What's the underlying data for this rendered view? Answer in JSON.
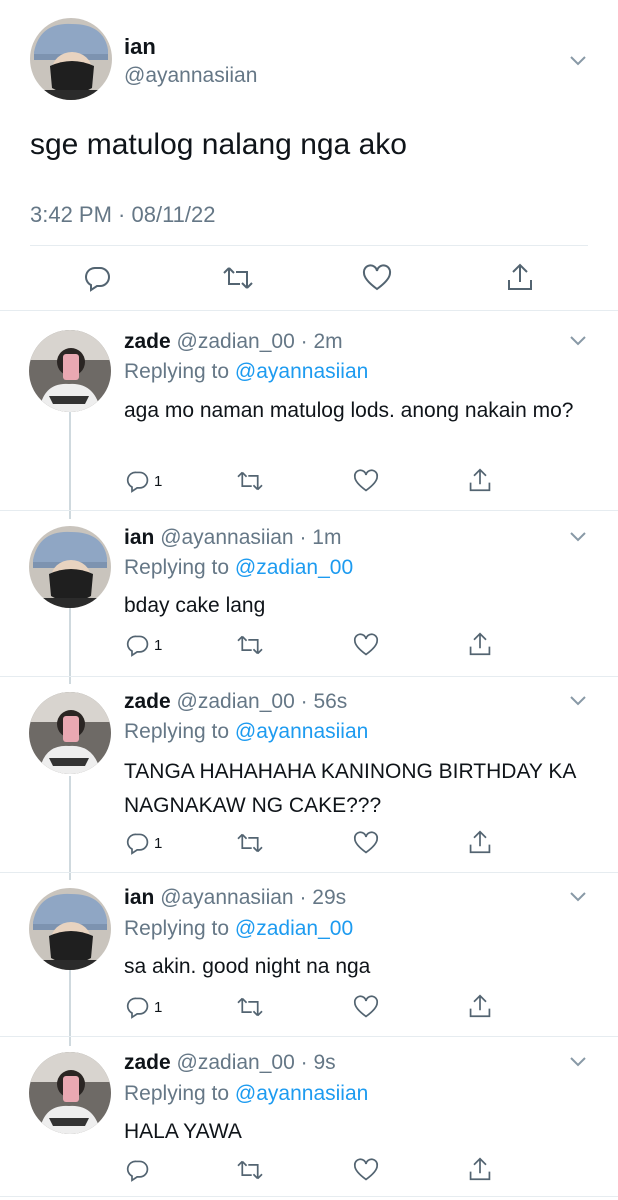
{
  "main_tweet": {
    "author_name": "ian",
    "author_handle": "@ayannasiian",
    "text": "sge matulog nalang nga ako",
    "timestamp": "3:42 PM · 08/11/22"
  },
  "replies": [
    {
      "name": "zade",
      "handle": "@zadian_00",
      "time": "· 2m",
      "replying_prefix": "Replying to",
      "replying_to": "@ayannasiian",
      "text": "aga mo naman matulog lods. anong nakain mo?",
      "reply_count": "1"
    },
    {
      "name": "ian",
      "handle": "@ayannasiian",
      "time": "· 1m",
      "replying_prefix": "Replying to",
      "replying_to": "@zadian_00",
      "text": "bday cake lang",
      "reply_count": "1"
    },
    {
      "name": "zade",
      "handle": "@zadian_00",
      "time": "· 56s",
      "replying_prefix": "Replying to",
      "replying_to": "@ayannasiian",
      "text": "TANGA HAHAHAHA KANINONG BIRTHDAY KA NAGNAKAW NG CAKE???",
      "reply_count": "1"
    },
    {
      "name": "ian",
      "handle": "@ayannasiian",
      "time": "· 29s",
      "replying_prefix": "Replying to",
      "replying_to": "@zadian_00",
      "text": "sa akin. good night na nga",
      "reply_count": "1"
    },
    {
      "name": "zade",
      "handle": "@zadian_00",
      "time": "· 9s",
      "replying_prefix": "Replying to",
      "replying_to": "@ayannasiian",
      "text": "HALA YAWA",
      "reply_count": ""
    }
  ],
  "icons": {
    "reply": "reply-icon",
    "retweet": "retweet-icon",
    "like": "like-icon",
    "share": "share-icon",
    "more": "chevron-down-icon"
  },
  "colors": {
    "link": "#1d9bf0",
    "muted": "#657786",
    "text": "#0f1419",
    "thread_line": "#cfd9de"
  }
}
